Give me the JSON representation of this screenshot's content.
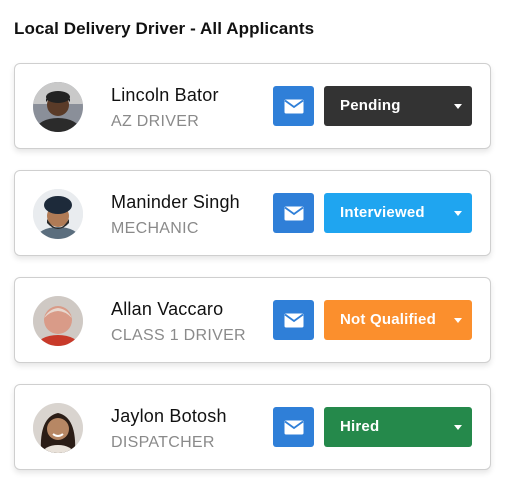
{
  "page": {
    "title": "Local Delivery Driver - All Applicants"
  },
  "applicants": [
    {
      "name": "Lincoln Bator",
      "role": "AZ DRIVER",
      "status": "Pending",
      "status_color": "#333333"
    },
    {
      "name": "Maninder Singh",
      "role": "MECHANIC",
      "status": "Interviewed",
      "status_color": "#1fa5f0"
    },
    {
      "name": "Allan Vaccaro",
      "role": "CLASS 1 DRIVER",
      "status": "Not Qualified",
      "status_color": "#fb8f2d"
    },
    {
      "name": "Jaylon Botosh",
      "role": "DISPATCHER",
      "status": "Hired",
      "status_color": "#25894b"
    }
  ],
  "colors": {
    "mail_button": "#2f7fd8"
  },
  "icons": {
    "mail": "envelope-icon",
    "dropdown": "chevron-down-icon"
  }
}
